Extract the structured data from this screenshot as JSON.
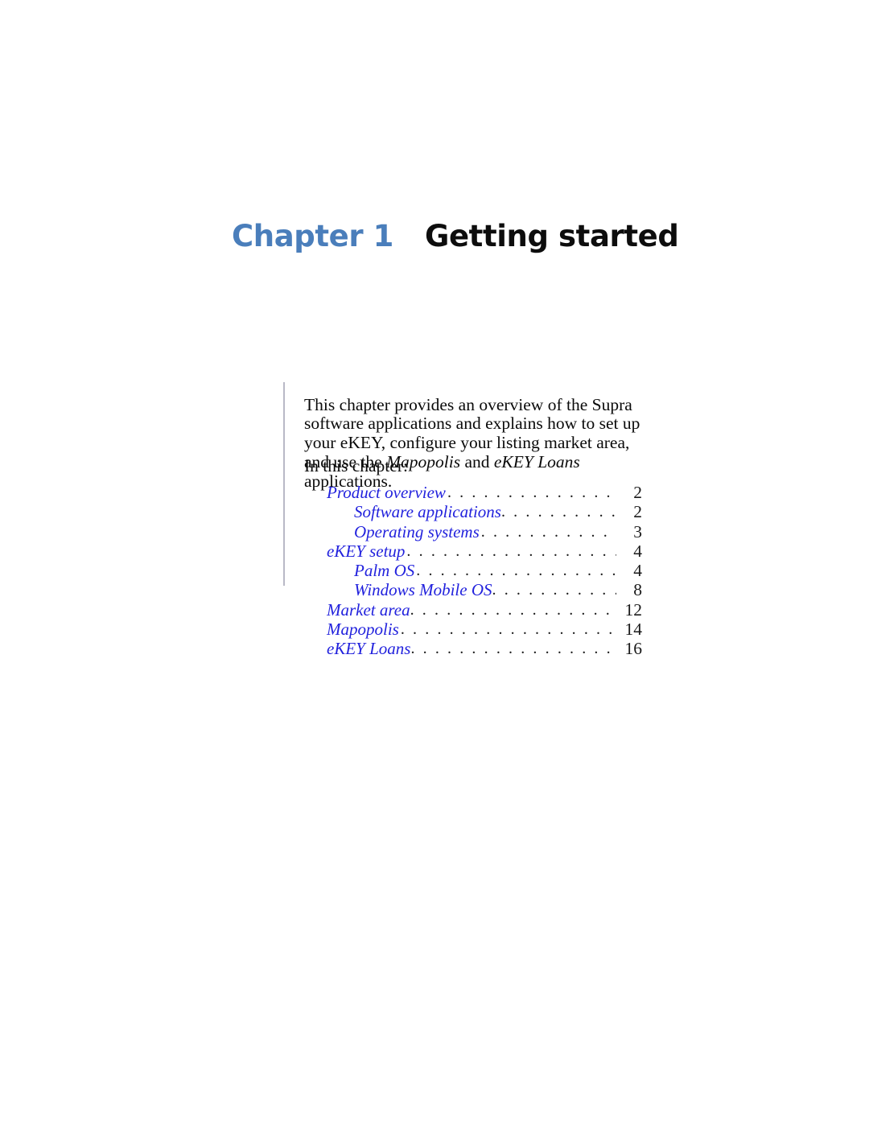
{
  "page": {
    "background_color": "#ffffff",
    "accent_blue": "#4a7ebb",
    "toc_blue": "#2222dd",
    "rule_color": "#b9b9c6"
  },
  "heading": {
    "chapter_label": "Chapter 1",
    "chapter_title": "Getting started"
  },
  "intro": {
    "paragraph_part1": "This chapter provides an overview of the Supra software applications and explains how to set up your eKEY, configure your listing market area, and use the ",
    "emphasis1": "Mapopolis",
    "paragraph_part2": " and ",
    "emphasis2": "eKEY Loans",
    "paragraph_part3": " applications.",
    "in_this_chapter_label": "In this chapter:"
  },
  "toc": {
    "entries": [
      {
        "title": "Product overview",
        "page": "2",
        "level": 1,
        "tight": false
      },
      {
        "title": "Software applications",
        "page": "2",
        "level": 2,
        "tight": true
      },
      {
        "title": "Operating systems",
        "page": "3",
        "level": 2,
        "tight": false
      },
      {
        "title": "eKEY setup",
        "page": "4",
        "level": 1,
        "tight": false
      },
      {
        "title": "Palm OS",
        "page": "4",
        "level": 2,
        "tight": false
      },
      {
        "title": "Windows Mobile OS",
        "page": "8",
        "level": 2,
        "tight": true
      },
      {
        "title": "Market area",
        "page": "12",
        "level": 1,
        "tight": true
      },
      {
        "title": "Mapopolis",
        "page": "14",
        "level": 1,
        "tight": false
      },
      {
        "title": "eKEY Loans",
        "page": "16",
        "level": 1,
        "tight": true
      }
    ]
  }
}
